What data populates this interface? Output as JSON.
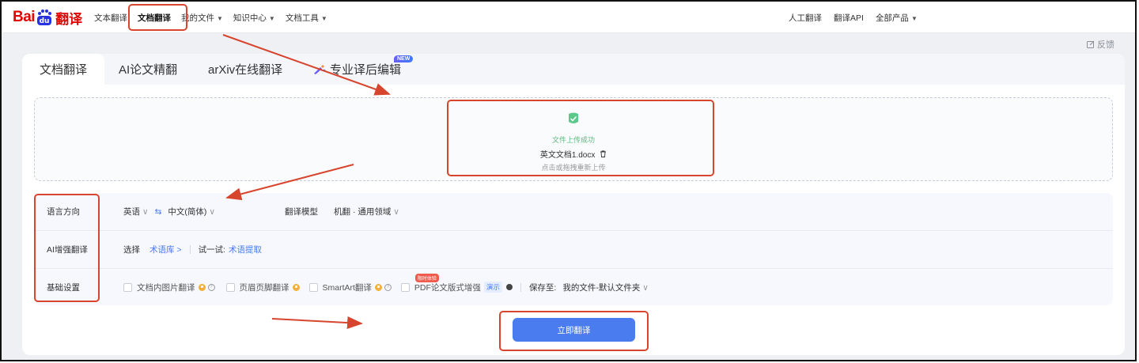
{
  "logo": {
    "bai": "Bai",
    "fy": "翻译"
  },
  "nav_left": [
    {
      "label": "文本翻译",
      "dropdown": false
    },
    {
      "label": "文档翻译",
      "dropdown": false,
      "active": true
    },
    {
      "label": "我的文件",
      "dropdown": true
    },
    {
      "label": "知识中心",
      "dropdown": true
    },
    {
      "label": "文档工具",
      "dropdown": true
    }
  ],
  "nav_right": [
    {
      "label": "人工翻译",
      "dropdown": false
    },
    {
      "label": "翻译API",
      "dropdown": false
    },
    {
      "label": "全部产品",
      "dropdown": true
    }
  ],
  "feedback": "反馈",
  "tabs": [
    "文档翻译",
    "AI论文精翻",
    "arXiv在线翻译",
    "专业译后编辑"
  ],
  "new_badge": "NEW",
  "upload": {
    "status": "文件上传成功",
    "filename": "英文文档1.docx",
    "tip": "点击或拖拽重新上传"
  },
  "settings": {
    "lang_label": "语言方向",
    "source_lang": "英语",
    "target_lang": "中文(简体)",
    "model_label": "翻译模型",
    "model_value": "机翻 · 通用领域",
    "ai_label": "AI增强翻译",
    "ai_select": "选择",
    "ai_term": "术语库 >",
    "ai_try": "试一试:",
    "ai_extract": "术语提取",
    "basic_label": "基础设置",
    "opt_image": "文档内图片翻译",
    "opt_header": "页眉页脚翻译",
    "opt_smartart": "SmartArt翻译",
    "opt_pdf": "PDF论文版式增强",
    "opt_limited": "限时体验",
    "opt_demo": "演示",
    "save_label": "保存至:",
    "save_value": "我的文件-默认文件夹"
  },
  "translate_button": "立即翻译",
  "colors": {
    "brand": "#e10600",
    "accent": "#4a7cf0",
    "annotation": "#d8452e",
    "success": "#5cba7d"
  }
}
